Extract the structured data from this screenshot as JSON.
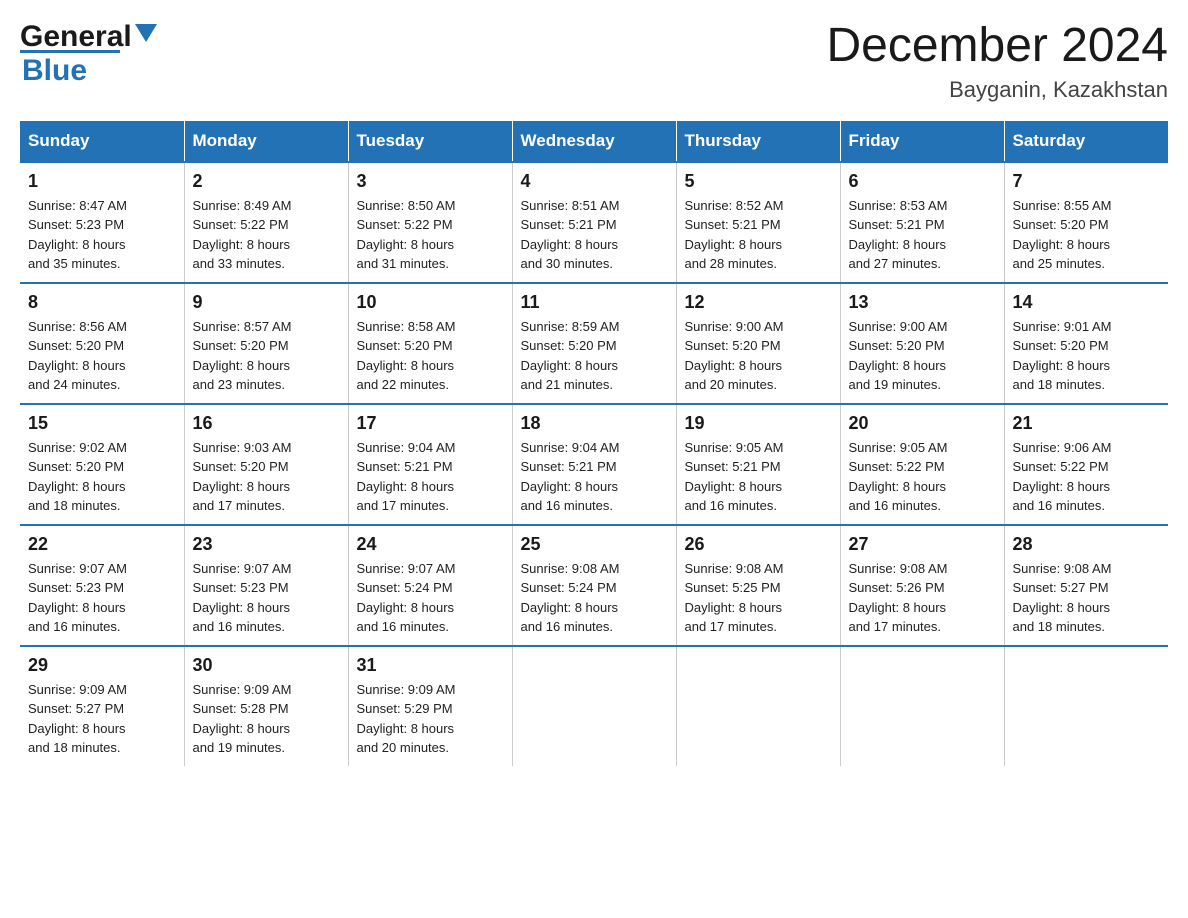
{
  "header": {
    "logo": {
      "general": "General",
      "blue": "Blue"
    },
    "title": "December 2024",
    "subtitle": "Bayganin, Kazakhstan"
  },
  "weekdays": [
    "Sunday",
    "Monday",
    "Tuesday",
    "Wednesday",
    "Thursday",
    "Friday",
    "Saturday"
  ],
  "weeks": [
    [
      {
        "day": "1",
        "sunrise": "8:47 AM",
        "sunset": "5:23 PM",
        "daylight": "8 hours and 35 minutes."
      },
      {
        "day": "2",
        "sunrise": "8:49 AM",
        "sunset": "5:22 PM",
        "daylight": "8 hours and 33 minutes."
      },
      {
        "day": "3",
        "sunrise": "8:50 AM",
        "sunset": "5:22 PM",
        "daylight": "8 hours and 31 minutes."
      },
      {
        "day": "4",
        "sunrise": "8:51 AM",
        "sunset": "5:21 PM",
        "daylight": "8 hours and 30 minutes."
      },
      {
        "day": "5",
        "sunrise": "8:52 AM",
        "sunset": "5:21 PM",
        "daylight": "8 hours and 28 minutes."
      },
      {
        "day": "6",
        "sunrise": "8:53 AM",
        "sunset": "5:21 PM",
        "daylight": "8 hours and 27 minutes."
      },
      {
        "day": "7",
        "sunrise": "8:55 AM",
        "sunset": "5:20 PM",
        "daylight": "8 hours and 25 minutes."
      }
    ],
    [
      {
        "day": "8",
        "sunrise": "8:56 AM",
        "sunset": "5:20 PM",
        "daylight": "8 hours and 24 minutes."
      },
      {
        "day": "9",
        "sunrise": "8:57 AM",
        "sunset": "5:20 PM",
        "daylight": "8 hours and 23 minutes."
      },
      {
        "day": "10",
        "sunrise": "8:58 AM",
        "sunset": "5:20 PM",
        "daylight": "8 hours and 22 minutes."
      },
      {
        "day": "11",
        "sunrise": "8:59 AM",
        "sunset": "5:20 PM",
        "daylight": "8 hours and 21 minutes."
      },
      {
        "day": "12",
        "sunrise": "9:00 AM",
        "sunset": "5:20 PM",
        "daylight": "8 hours and 20 minutes."
      },
      {
        "day": "13",
        "sunrise": "9:00 AM",
        "sunset": "5:20 PM",
        "daylight": "8 hours and 19 minutes."
      },
      {
        "day": "14",
        "sunrise": "9:01 AM",
        "sunset": "5:20 PM",
        "daylight": "8 hours and 18 minutes."
      }
    ],
    [
      {
        "day": "15",
        "sunrise": "9:02 AM",
        "sunset": "5:20 PM",
        "daylight": "8 hours and 18 minutes."
      },
      {
        "day": "16",
        "sunrise": "9:03 AM",
        "sunset": "5:20 PM",
        "daylight": "8 hours and 17 minutes."
      },
      {
        "day": "17",
        "sunrise": "9:04 AM",
        "sunset": "5:21 PM",
        "daylight": "8 hours and 17 minutes."
      },
      {
        "day": "18",
        "sunrise": "9:04 AM",
        "sunset": "5:21 PM",
        "daylight": "8 hours and 16 minutes."
      },
      {
        "day": "19",
        "sunrise": "9:05 AM",
        "sunset": "5:21 PM",
        "daylight": "8 hours and 16 minutes."
      },
      {
        "day": "20",
        "sunrise": "9:05 AM",
        "sunset": "5:22 PM",
        "daylight": "8 hours and 16 minutes."
      },
      {
        "day": "21",
        "sunrise": "9:06 AM",
        "sunset": "5:22 PM",
        "daylight": "8 hours and 16 minutes."
      }
    ],
    [
      {
        "day": "22",
        "sunrise": "9:07 AM",
        "sunset": "5:23 PM",
        "daylight": "8 hours and 16 minutes."
      },
      {
        "day": "23",
        "sunrise": "9:07 AM",
        "sunset": "5:23 PM",
        "daylight": "8 hours and 16 minutes."
      },
      {
        "day": "24",
        "sunrise": "9:07 AM",
        "sunset": "5:24 PM",
        "daylight": "8 hours and 16 minutes."
      },
      {
        "day": "25",
        "sunrise": "9:08 AM",
        "sunset": "5:24 PM",
        "daylight": "8 hours and 16 minutes."
      },
      {
        "day": "26",
        "sunrise": "9:08 AM",
        "sunset": "5:25 PM",
        "daylight": "8 hours and 17 minutes."
      },
      {
        "day": "27",
        "sunrise": "9:08 AM",
        "sunset": "5:26 PM",
        "daylight": "8 hours and 17 minutes."
      },
      {
        "day": "28",
        "sunrise": "9:08 AM",
        "sunset": "5:27 PM",
        "daylight": "8 hours and 18 minutes."
      }
    ],
    [
      {
        "day": "29",
        "sunrise": "9:09 AM",
        "sunset": "5:27 PM",
        "daylight": "8 hours and 18 minutes."
      },
      {
        "day": "30",
        "sunrise": "9:09 AM",
        "sunset": "5:28 PM",
        "daylight": "8 hours and 19 minutes."
      },
      {
        "day": "31",
        "sunrise": "9:09 AM",
        "sunset": "5:29 PM",
        "daylight": "8 hours and 20 minutes."
      },
      null,
      null,
      null,
      null
    ]
  ],
  "labels": {
    "sunrise": "Sunrise:",
    "sunset": "Sunset:",
    "daylight": "Daylight:"
  }
}
